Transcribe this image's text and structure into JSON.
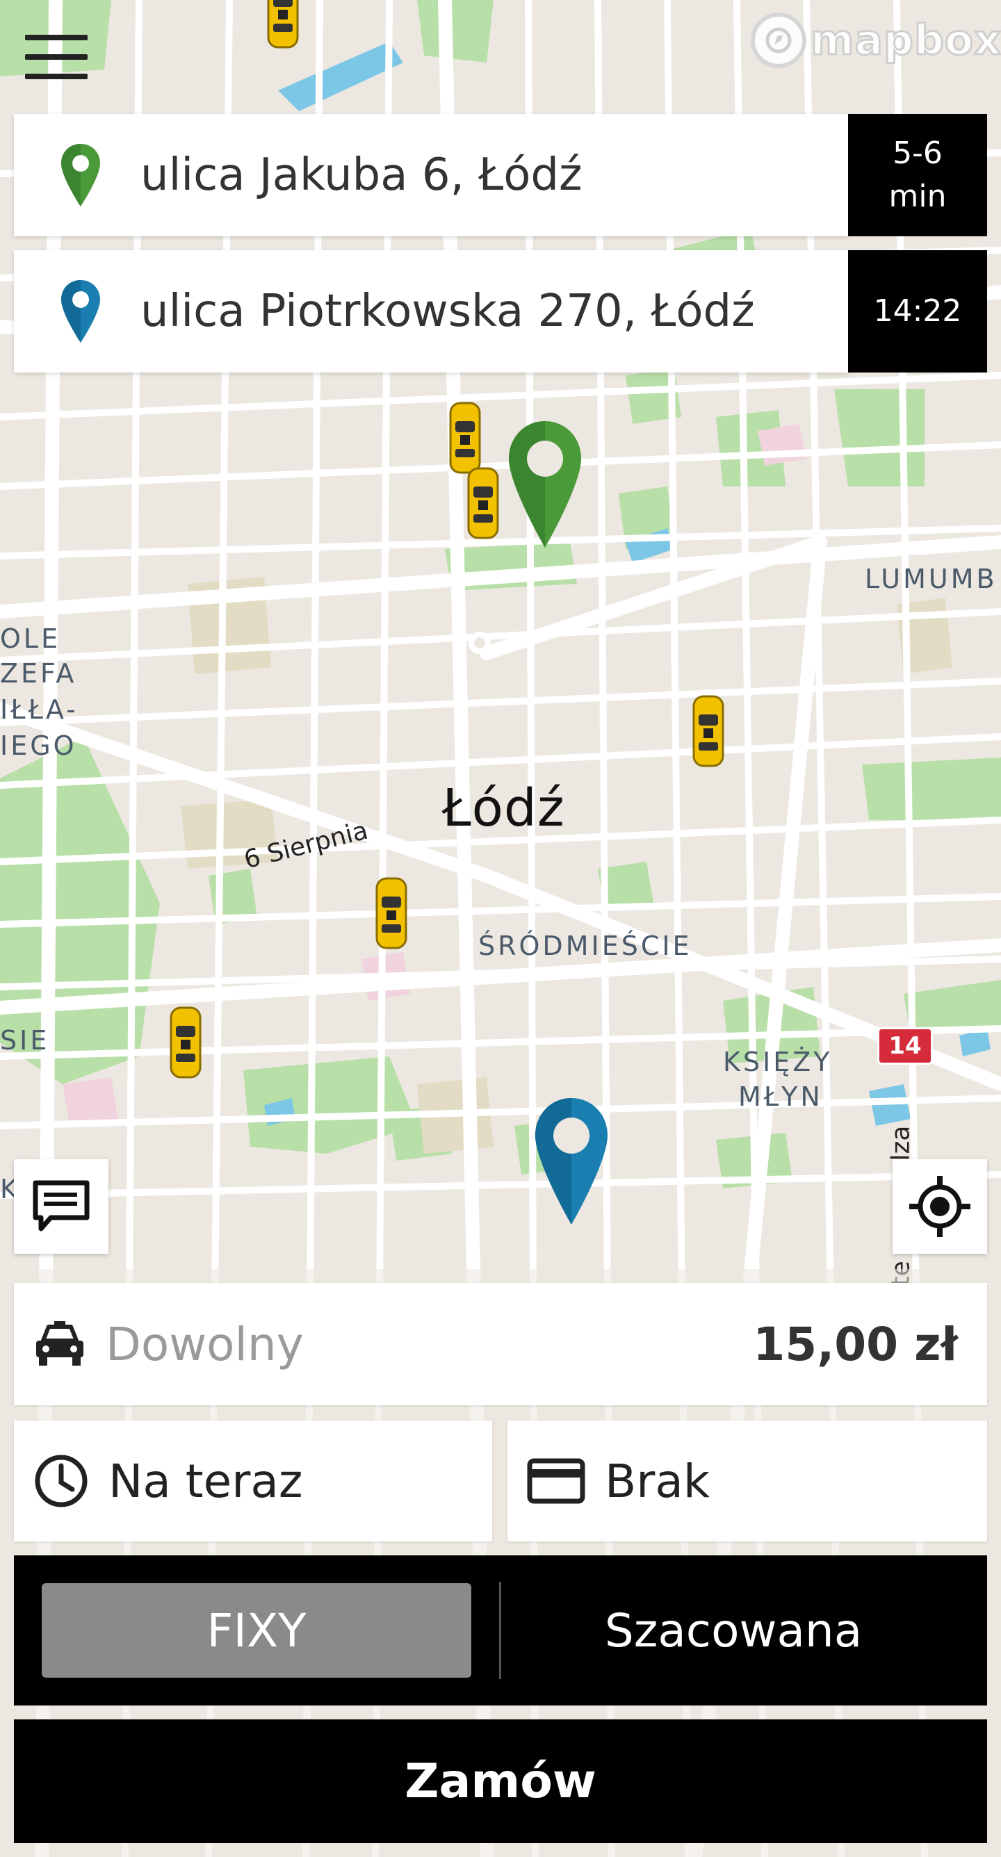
{
  "header": {
    "menu_icon": "hamburger-menu-icon",
    "map_attribution": "mapbox"
  },
  "route": {
    "pickup": {
      "address": "ulica Jakuba 6, Łódź",
      "eta_line1": "5-6",
      "eta_line2": "min",
      "pin_color": "#4a9a3a"
    },
    "destination": {
      "address": "ulica Piotrkowska 270, Łódź",
      "arrival_time": "14:22",
      "pin_color": "#1a7fb0"
    }
  },
  "map": {
    "city": "Łódź",
    "districts": {
      "srodmiescie": "ŚRÓDMIEŚCIE",
      "ksiezy_mlyn_line1": "KSIĘŻY",
      "ksiezy_mlyn_line2": "MŁYN",
      "lumumbowo_partial": "LUMUMB",
      "park_partial_1": "OLE",
      "park_partial_2": "ZEFA",
      "park_partial_3": "IŁŁA-",
      "park_partial_4": "IEGO",
      "west_partial": "SIE",
      "left_edge_partial": "K"
    },
    "streets": {
      "sierpnia": "6 Sierpnia",
      "right_edge_1": "lza",
      "right_edge_2": "te"
    },
    "road_shield": "14",
    "taxi_count": 7
  },
  "controls": {
    "chat_icon": "chat-bubble-icon",
    "locate_icon": "my-location-icon"
  },
  "order": {
    "vehicle_type": "Dowolny",
    "price": "15,00 zł",
    "time": "Na teraz",
    "payment": "Brak",
    "fare_options": {
      "fixed": "FIXY",
      "estimated": "Szacowana",
      "selected": "FIXY"
    },
    "submit_label": "Zamów"
  }
}
